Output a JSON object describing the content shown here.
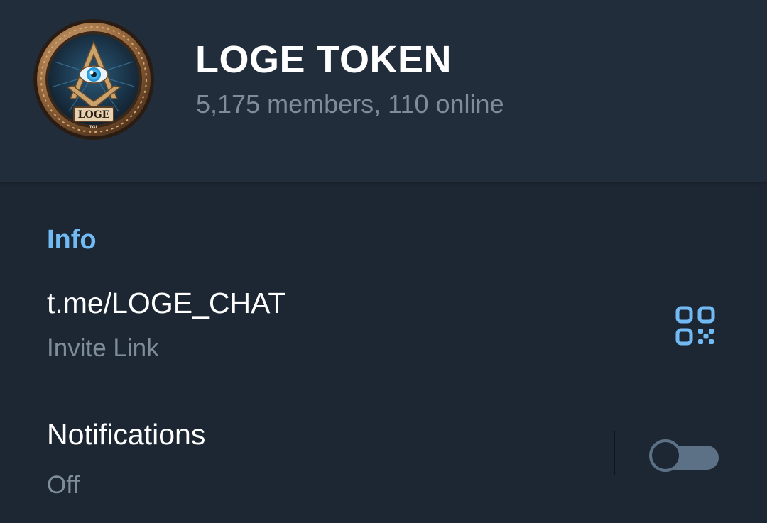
{
  "header": {
    "title": "LOGE TOKEN",
    "subtitle": "5,175 members, 110 online",
    "avatar_label": "LOGE",
    "avatar_sublabel": "TGL"
  },
  "info": {
    "section_title": "Info",
    "invite": {
      "value": "t.me/LOGE_CHAT",
      "label": "Invite Link",
      "icon": "qr-code-icon"
    },
    "notifications": {
      "label": "Notifications",
      "value": "Off",
      "enabled": false
    }
  },
  "colors": {
    "background": "#1d2733",
    "header_background": "#212d3b",
    "accent": "#71baf4",
    "secondary_text": "#7f8d9b",
    "toggle_off": "#5d7186"
  }
}
